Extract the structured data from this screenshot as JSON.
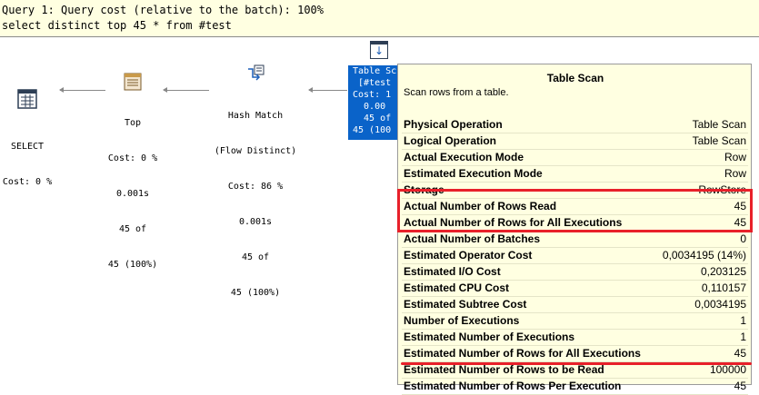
{
  "header": {
    "line1": "Query 1: Query cost (relative to the batch): 100%",
    "line2": "select distinct top 45 * from #test"
  },
  "plan": {
    "select": {
      "name": "SELECT",
      "cost": "Cost: 0 %"
    },
    "top": {
      "name": "Top",
      "cost": "Cost: 0 %",
      "time": "0.001s",
      "rows": "45 of",
      "pct": "45 (100%)"
    },
    "hash": {
      "name": "Hash Match",
      "sub": "(Flow Distinct)",
      "cost": "Cost: 86 %",
      "time": "0.001s",
      "rows": "45 of",
      "pct": "45 (100%)"
    },
    "scan": {
      "line1": "Table Sc",
      "line2": " [#test",
      "line3": "Cost: 1",
      "line4": "  0.00",
      "line5": "  45 of",
      "line6": "45 (100"
    }
  },
  "tooltip": {
    "title": "Table Scan",
    "description": "Scan rows from a table.",
    "rows": [
      {
        "label": "Physical Operation",
        "value": "Table Scan"
      },
      {
        "label": "Logical Operation",
        "value": "Table Scan"
      },
      {
        "label": "Actual Execution Mode",
        "value": "Row"
      },
      {
        "label": "Estimated Execution Mode",
        "value": "Row"
      },
      {
        "label": "Storage",
        "value": "RowStore"
      },
      {
        "label": "Actual Number of Rows Read",
        "value": "45"
      },
      {
        "label": "Actual Number of Rows for All Executions",
        "value": "45"
      },
      {
        "label": "Actual Number of Batches",
        "value": "0"
      },
      {
        "label": "Estimated Operator Cost",
        "value": "0,0034195 (14%)"
      },
      {
        "label": "Estimated I/O Cost",
        "value": "0,203125"
      },
      {
        "label": "Estimated CPU Cost",
        "value": "0,110157"
      },
      {
        "label": "Estimated Subtree Cost",
        "value": "0,0034195"
      },
      {
        "label": "Number of Executions",
        "value": "1"
      },
      {
        "label": "Estimated Number of Executions",
        "value": "1"
      },
      {
        "label": "Estimated Number of Rows for All Executions",
        "value": "45"
      },
      {
        "label": "Estimated Number of Rows to be Read",
        "value": "100000"
      },
      {
        "label": "Estimated Number of Rows Per Execution",
        "value": "45"
      }
    ]
  },
  "colors": {
    "highlight": "#e8202a",
    "selection": "#0a63c9",
    "tooltip_bg": "#ffffe1"
  },
  "icons": [
    "select-icon",
    "top-icon",
    "hash-match-icon",
    "table-scan-icon"
  ]
}
